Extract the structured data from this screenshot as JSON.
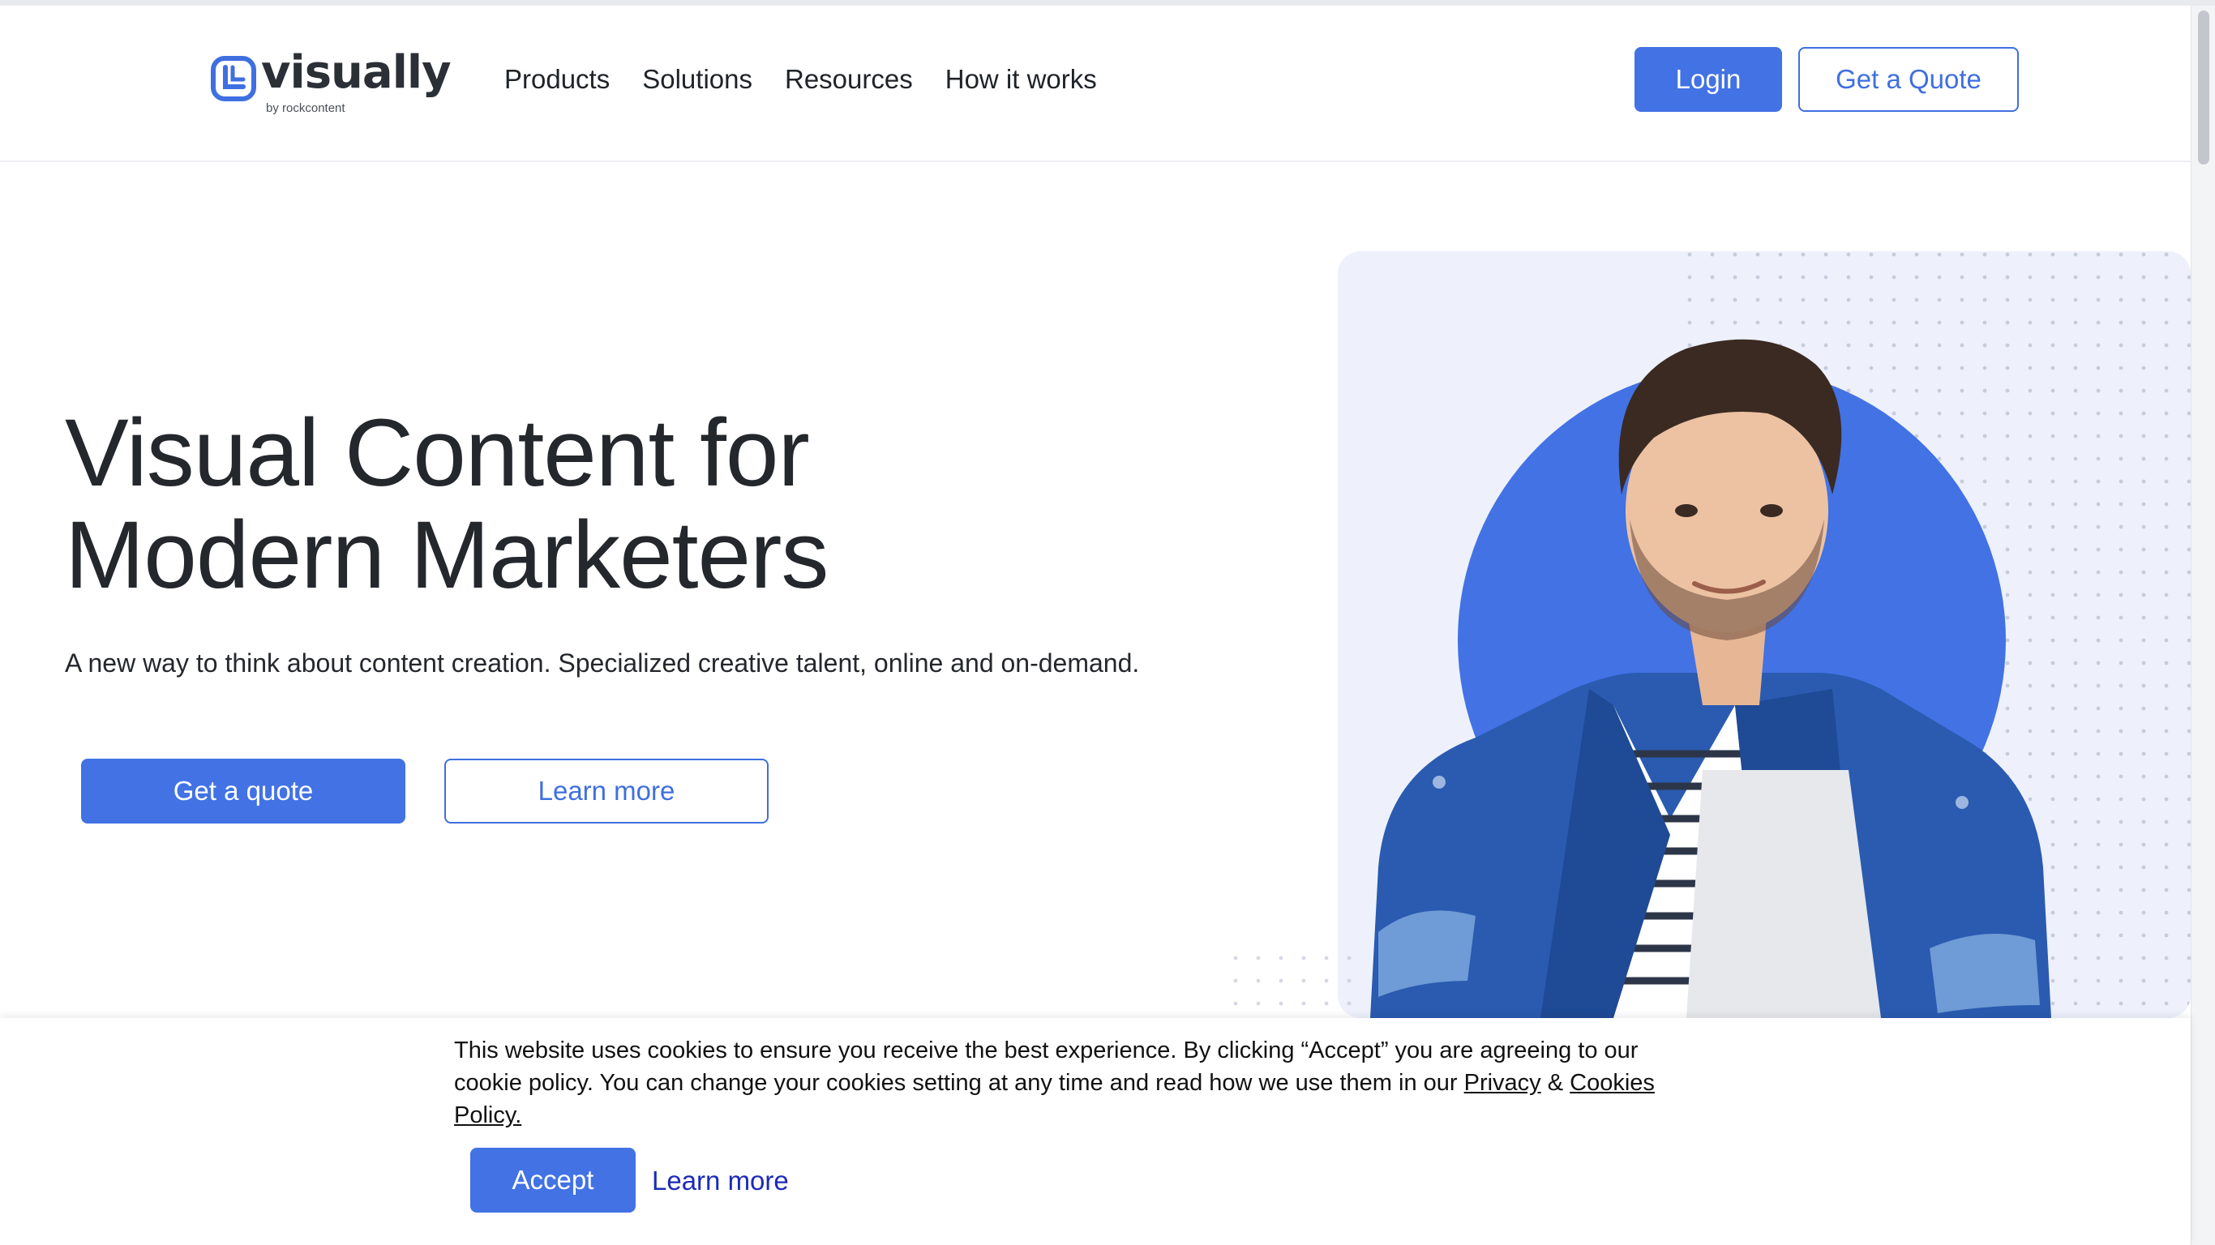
{
  "brand": {
    "name": "visually",
    "tagline": "by rockcontent",
    "accent_color": "#4272e4"
  },
  "nav": {
    "items": [
      {
        "label": "Products"
      },
      {
        "label": "Solutions"
      },
      {
        "label": "Resources"
      },
      {
        "label": "How it works"
      }
    ],
    "login_label": "Login",
    "quote_label": "Get a Quote"
  },
  "hero": {
    "title_line1": "Visual Content for",
    "title_line2": "Modern Marketers",
    "subtitle": "A new way to think about content creation. Specialized creative talent, online and on-demand.",
    "primary_cta": "Get a quote",
    "secondary_cta": "Learn more",
    "image": "man-in-denim-jacket-holding-laptop"
  },
  "cookie_banner": {
    "text": "This website uses cookies to ensure you receive the best experience. By clicking “Accept” you are agreeing to our cookie policy. You can change your cookies setting at any time and read how we use them in our",
    "privacy_link": "Privacy",
    "ampersand": "&",
    "cookies_link": "Cookies Policy.",
    "accept_label": "Accept",
    "learn_more_label": "Learn more"
  }
}
